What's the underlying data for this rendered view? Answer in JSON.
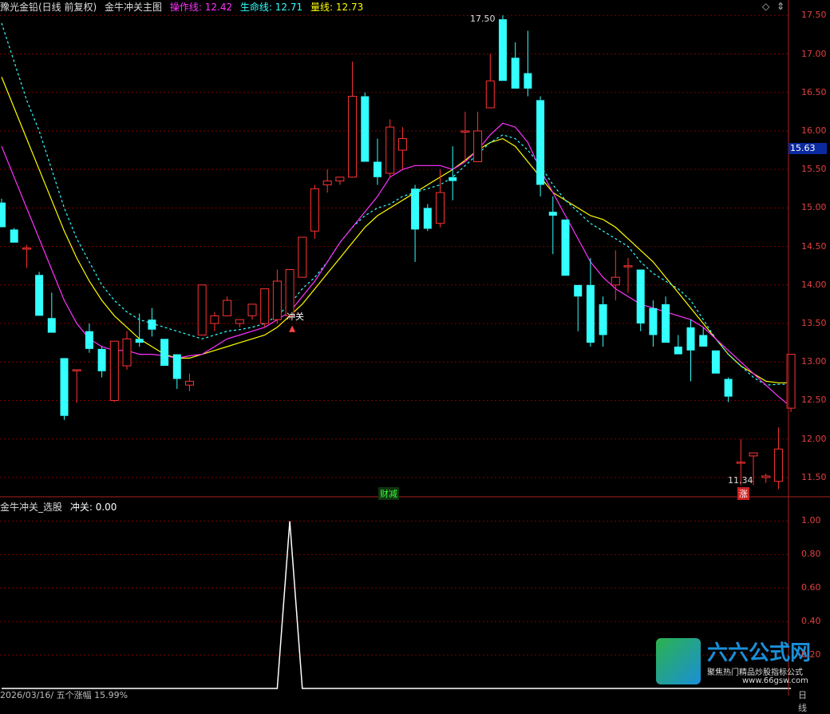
{
  "header": {
    "title": "豫光金铅(日线 前复权)",
    "indicator_name": "金牛冲关主图",
    "lines": [
      {
        "label": "操作线",
        "value": "12.42",
        "color": "#ff33ff"
      },
      {
        "label": "生命线",
        "value": "12.71",
        "color": "#33ffff"
      },
      {
        "label": "量线",
        "value": "12.73",
        "color": "#ffff00"
      }
    ]
  },
  "sub_header": {
    "title": "金牛冲关_选股",
    "signal_label": "冲关",
    "signal_value": "0.00"
  },
  "controls": {
    "diamond": "◇",
    "updown": "⇕"
  },
  "price_badge": "15.63",
  "annotations": {
    "high_label": "17.50",
    "low_label": "11.34",
    "breakout_label": "冲关",
    "finance_tag": "财减",
    "rise_tag": "涨"
  },
  "bottom_bar": {
    "date_info": "2026/03/16/ 五个涨幅 15.99%",
    "period": "日线"
  },
  "logo": {
    "title": "六六公式网",
    "sub": "聚焦热门精品炒股指标公式",
    "url": "www.66gsw.com"
  },
  "colors": {
    "up": "#ff3333",
    "down": "#33ffff",
    "ma_operate": "#ff33ff",
    "ma_life": "#33ffff",
    "ma_volume": "#ffff00",
    "grid": "#7a0000",
    "signal": "#ffffff"
  },
  "chart_data": [
    {
      "type": "candlestick",
      "y_ticks": [
        "17.50",
        "17.00",
        "16.50",
        "16.00",
        "15.50",
        "15.00",
        "14.50",
        "14.00",
        "13.50",
        "13.00",
        "12.50",
        "12.00",
        "11.50"
      ],
      "ylim": [
        11.25,
        17.7
      ],
      "candles": [
        [
          15.07,
          15.12,
          14.75,
          14.75
        ],
        [
          14.72,
          14.74,
          14.55,
          14.55
        ],
        [
          14.48,
          14.52,
          14.22,
          14.48
        ],
        [
          14.13,
          14.17,
          13.6,
          13.6
        ],
        [
          13.57,
          13.9,
          13.38,
          13.38
        ],
        [
          13.05,
          13.05,
          12.25,
          12.3
        ],
        [
          12.9,
          12.9,
          12.47,
          12.9
        ],
        [
          13.4,
          13.5,
          13.12,
          13.17
        ],
        [
          13.17,
          13.2,
          12.8,
          12.88
        ],
        [
          12.5,
          13.2,
          12.48,
          13.27
        ],
        [
          12.95,
          13.4,
          12.9,
          13.3
        ],
        [
          13.3,
          13.63,
          13.2,
          13.25
        ],
        [
          13.55,
          13.7,
          13.33,
          13.42
        ],
        [
          13.3,
          13.3,
          12.95,
          12.95
        ],
        [
          13.1,
          13.1,
          12.65,
          12.78
        ],
        [
          12.7,
          12.85,
          12.62,
          12.75
        ],
        [
          13.35,
          14.0,
          13.35,
          14.0
        ],
        [
          13.5,
          13.65,
          13.4,
          13.6
        ],
        [
          13.6,
          13.85,
          13.6,
          13.8
        ],
        [
          13.5,
          13.55,
          13.45,
          13.55
        ],
        [
          13.6,
          13.75,
          13.55,
          13.75
        ],
        [
          13.5,
          13.95,
          13.45,
          13.95
        ],
        [
          13.55,
          14.2,
          13.5,
          14.05
        ],
        [
          13.6,
          14.2,
          13.55,
          14.2
        ],
        [
          14.1,
          14.5,
          14.1,
          14.62
        ],
        [
          14.7,
          15.3,
          14.6,
          15.25
        ],
        [
          15.3,
          15.5,
          15.2,
          15.35
        ],
        [
          15.35,
          15.4,
          15.3,
          15.4
        ],
        [
          15.4,
          16.9,
          15.4,
          16.45
        ],
        [
          16.45,
          16.5,
          15.6,
          15.6
        ],
        [
          15.6,
          15.9,
          15.3,
          15.4
        ],
        [
          15.45,
          16.15,
          15.4,
          16.05
        ],
        [
          15.75,
          16.05,
          15.5,
          15.9
        ],
        [
          15.25,
          15.3,
          14.3,
          14.72
        ],
        [
          15.0,
          15.05,
          14.7,
          14.73
        ],
        [
          14.8,
          15.5,
          14.75,
          15.2
        ],
        [
          15.4,
          15.8,
          15.1,
          15.35
        ],
        [
          16.0,
          16.25,
          15.6,
          16.0
        ],
        [
          15.6,
          16.25,
          15.6,
          16.0
        ],
        [
          16.3,
          17.0,
          16.3,
          16.65
        ],
        [
          17.45,
          17.5,
          16.65,
          16.65
        ],
        [
          16.95,
          17.15,
          16.55,
          16.55
        ],
        [
          16.75,
          17.3,
          16.45,
          16.55
        ],
        [
          16.4,
          16.45,
          15.15,
          15.3
        ],
        [
          14.95,
          15.15,
          14.4,
          14.9
        ],
        [
          14.85,
          14.85,
          14.12,
          14.12
        ],
        [
          14.0,
          14.0,
          13.4,
          13.85
        ],
        [
          14.0,
          14.35,
          13.2,
          13.25
        ],
        [
          13.75,
          13.85,
          13.2,
          13.35
        ],
        [
          14.0,
          14.45,
          13.8,
          14.1
        ],
        [
          14.25,
          14.35,
          13.9,
          14.25
        ],
        [
          14.2,
          14.2,
          13.4,
          13.5
        ],
        [
          13.7,
          13.8,
          13.2,
          13.35
        ],
        [
          13.75,
          13.85,
          13.25,
          13.25
        ],
        [
          13.2,
          13.35,
          13.1,
          13.1
        ],
        [
          13.45,
          13.55,
          12.75,
          13.15
        ],
        [
          13.35,
          13.45,
          13.2,
          13.2
        ],
        [
          13.15,
          13.15,
          12.85,
          12.85
        ],
        [
          12.78,
          12.8,
          12.48,
          12.55
        ],
        [
          11.7,
          12.0,
          11.4,
          11.7
        ],
        [
          11.78,
          11.8,
          11.4,
          11.82
        ],
        [
          11.5,
          11.55,
          11.43,
          11.52
        ],
        [
          11.45,
          12.15,
          11.35,
          11.87
        ],
        [
          12.4,
          13.1,
          12.35,
          13.1
        ]
      ],
      "ma_operate": [
        15.8,
        15.4,
        15.0,
        14.6,
        14.2,
        13.8,
        13.5,
        13.3,
        13.2,
        13.15,
        13.15,
        13.1,
        13.1,
        13.08,
        13.05,
        13.08,
        13.1,
        13.2,
        13.3,
        13.35,
        13.4,
        13.45,
        13.55,
        13.65,
        13.85,
        14.05,
        14.3,
        14.55,
        14.75,
        14.95,
        15.15,
        15.4,
        15.5,
        15.55,
        15.55,
        15.55,
        15.5,
        15.6,
        15.75,
        15.95,
        16.1,
        16.05,
        15.85,
        15.5,
        15.2,
        14.9,
        14.6,
        14.3,
        14.1,
        13.95,
        13.85,
        13.75,
        13.7,
        13.65,
        13.6,
        13.55,
        13.45,
        13.3,
        13.15,
        13.0,
        12.85,
        12.7,
        12.55,
        12.42
      ],
      "ma_life": [
        17.4,
        16.9,
        16.4,
        16.0,
        15.5,
        15.0,
        14.6,
        14.3,
        14.0,
        13.8,
        13.65,
        13.55,
        13.5,
        13.45,
        13.4,
        13.35,
        13.3,
        13.35,
        13.4,
        13.42,
        13.45,
        13.5,
        13.6,
        13.75,
        13.95,
        14.1,
        14.3,
        14.55,
        14.75,
        14.9,
        15.0,
        15.05,
        15.15,
        15.2,
        15.25,
        15.3,
        15.4,
        15.55,
        15.7,
        15.85,
        15.95,
        15.9,
        15.75,
        15.55,
        15.3,
        15.1,
        14.95,
        14.8,
        14.7,
        14.6,
        14.5,
        14.3,
        14.15,
        14.05,
        13.95,
        13.8,
        13.55,
        13.3,
        13.1,
        12.95,
        12.8,
        12.7,
        12.71,
        12.71
      ],
      "ma_volume": [
        16.7,
        16.3,
        15.9,
        15.5,
        15.1,
        14.7,
        14.35,
        14.05,
        13.8,
        13.6,
        13.45,
        13.3,
        13.2,
        13.1,
        13.05,
        13.05,
        13.1,
        13.15,
        13.2,
        13.25,
        13.3,
        13.35,
        13.45,
        13.6,
        13.75,
        13.95,
        14.15,
        14.35,
        14.55,
        14.75,
        14.9,
        15.0,
        15.1,
        15.2,
        15.3,
        15.4,
        15.5,
        15.62,
        15.75,
        15.85,
        15.9,
        15.8,
        15.6,
        15.4,
        15.2,
        15.1,
        15.0,
        14.9,
        14.85,
        14.75,
        14.6,
        14.45,
        14.3,
        14.1,
        13.9,
        13.7,
        13.5,
        13.3,
        13.1,
        12.95,
        12.85,
        12.75,
        12.73,
        12.73
      ]
    },
    {
      "type": "line",
      "name": "冲关",
      "y_ticks": [
        "1.00",
        "0.80",
        "0.60",
        "0.40",
        "0.20"
      ],
      "ylim": [
        0,
        1.05
      ],
      "values": [
        0,
        0,
        0,
        0,
        0,
        0,
        0,
        0,
        0,
        0,
        0,
        0,
        0,
        0,
        0,
        0,
        0,
        0,
        0,
        0,
        0,
        0,
        0,
        1,
        0,
        0,
        0,
        0,
        0,
        0,
        0,
        0,
        0,
        0,
        0,
        0,
        0,
        0,
        0,
        0,
        0,
        0,
        0,
        0,
        0,
        0,
        0,
        0,
        0,
        0,
        0,
        0,
        0,
        0,
        0,
        0,
        0,
        0,
        0,
        0,
        0,
        0,
        0,
        0
      ]
    }
  ]
}
